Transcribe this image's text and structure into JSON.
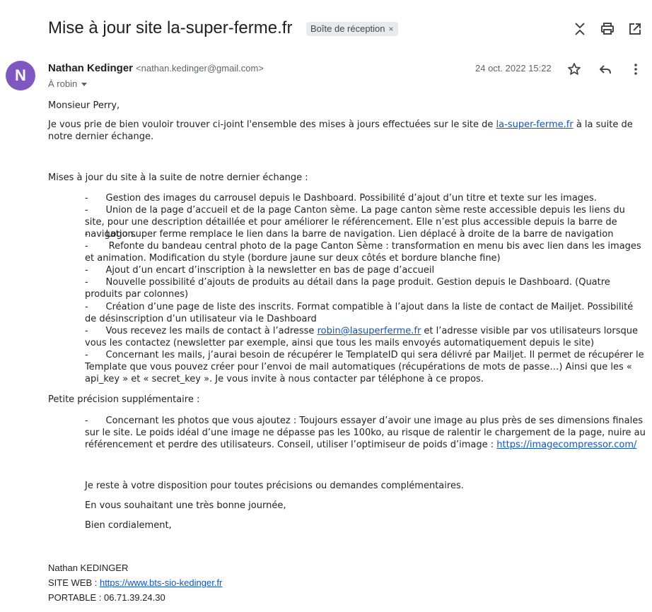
{
  "header": {
    "subject": "Mise à jour site la-super-ferme.fr",
    "label": "Boîte de réception",
    "label_remove": "×",
    "icons": [
      "collapse-icon",
      "print-icon",
      "open-in-new-window-icon"
    ]
  },
  "sender": {
    "avatar_letter": "N",
    "avatar_color": "#7e57c2",
    "name": "Nathan Kedinger",
    "email": "<nathan.kedinger@gmail.com>",
    "to": "À robin",
    "date": "24 oct. 2022 15:22",
    "icons": [
      "star-icon",
      "reply-icon",
      "more-vert-icon"
    ]
  },
  "body": {
    "greeting": "Monsieur Perry,",
    "intro_before": "Je vous prie de bien vouloir trouver ci-joint l'ensemble des mises à jours effectuées sur le site de ",
    "intro_link": "la-super-ferme.fr",
    "intro_after": " à la suite de notre dernier échange.",
    "updates_heading": "Mises à jour du site à la suite de notre dernier échange :",
    "bullet": "-",
    "items": [
      "Gestion des images du carrousel depuis le Dashboard. Possibilité d’ajout d’un titre et texte sur les images.",
      "Union de la page d’accueil et de la page Canton sème. La page canton sème reste accessible depuis les liens du site, pour une description détaillée et pour améliorer le référencement. Elle n’est plus accessible depuis la barre de navigation.",
      "Logo super ferme remplace le lien dans la barre de navigation. Lien déplacé à droite de la barre de navigation",
      " Refonte du bandeau central photo de la page Canton Sème : transformation en menu bis avec lien dans les images et animation. Modification du style (bordure jaune sur deux côtés et bordure blanche fine)",
      "Ajout d’un encart d’inscription à la newsletter en bas de page d’accueil",
      "Nouvelle possibilité d’ajouts de produits au détail dans la page produit. Gestion depuis le Dashboard. (Quatre produits par colonnes)",
      "Création d’une page de liste des inscrits. Format compatible à l’ajout dans la liste de contact de Mailjet. Possibilité de désinscription d’un utilisateur via le Dashboard"
    ],
    "item_mail_before": "Vous recevez les mails de contact à l’adresse ",
    "item_mail_link": "robin@lasuperferme.fr",
    "item_mail_after": " et l’adresse visible par vos utilisateurs lorsque vous les contactez (newsletter par exemple, ainsi que tous les mails envoyés automatiquement depuis le site)",
    "item_template": "Concernant les mails, j’aurai besoin de récupérer le TemplateID qui sera délivré par Mailjet. Il permet de récupérer le Template que vous pouvez créer pour l’envoi de mail automatiques (récupérations de mots de passe…) Ainsi que les « api_key » et « secret_key ». Je vous invite à nous contacter par téléphone à ce propos.",
    "precision_heading": "Petite précision supplémentaire :",
    "precision_before": "Concernant les photos que vous ajoutez : Toujours essayer d’avoir une image au plus près de ses dimensions finales sur le site. Le poids idéal d’une image ne dépasse pas les 100ko, au risque de ralentir le chargement de la page, nuire au référencement et perdre des utilisateurs. Conseil, utiliser l’optimiseur de poids d’image : ",
    "precision_link": "https://imagecompressor.com/",
    "closing_1": "Je reste à votre disposition pour toutes précisions ou demandes complémentaires.",
    "closing_2": "En vous souhaitant une très bonne journée,",
    "closing_3": "Bien cordialement,"
  },
  "signature": {
    "name": "Nathan KEDINGER",
    "site_label": "SITE WEB : ",
    "site_link": "https://www.bts-sio-kedinger.fr",
    "phone": "PORTABLE : 06.71.39.24.30"
  }
}
